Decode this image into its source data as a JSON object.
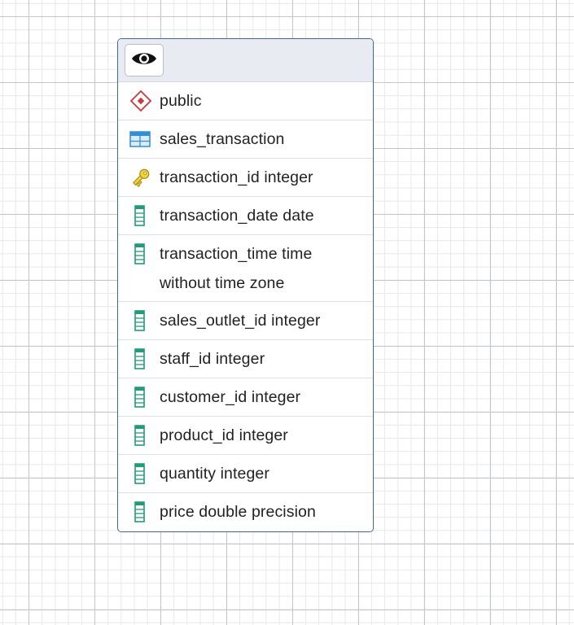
{
  "node": {
    "header_icon": "eye-icon",
    "schema": {
      "icon": "schema-diamond-icon",
      "label": "public"
    },
    "table": {
      "icon": "table-grid-icon",
      "label": "sales_transaction"
    },
    "columns": [
      {
        "icon": "primary-key-icon",
        "label": "transaction_id integer"
      },
      {
        "icon": "column-icon",
        "label": "transaction_date date"
      },
      {
        "icon": "column-icon",
        "label": "transaction_time time without time zone"
      },
      {
        "icon": "column-icon",
        "label": "sales_outlet_id integer"
      },
      {
        "icon": "column-icon",
        "label": "staff_id integer"
      },
      {
        "icon": "column-icon",
        "label": "customer_id integer"
      },
      {
        "icon": "column-icon",
        "label": "product_id integer"
      },
      {
        "icon": "column-icon",
        "label": "quantity integer"
      },
      {
        "icon": "column-icon",
        "label": "price double precision"
      }
    ]
  },
  "colors": {
    "node_border": "#3a6a9a",
    "header_bg": "#e8ecf2",
    "schema_icon": "#d0393b",
    "table_icon": "#2f8fd8",
    "key_icon": "#e8c420",
    "column_icon": "#1f9c7a"
  }
}
